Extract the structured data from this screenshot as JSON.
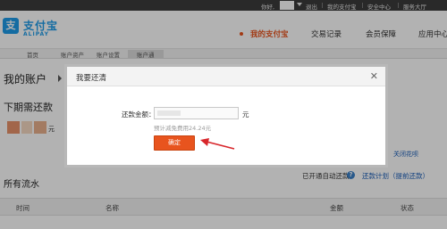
{
  "topbar": {
    "greeting": "你好,",
    "logout": "退出",
    "my_alipay": "我的支付宝",
    "security": "安全中心",
    "service": "服务大厅"
  },
  "header": {
    "logo_cn": "支付宝",
    "logo_en": "ALIPAY",
    "nav": [
      "我的支付宝",
      "交易记录",
      "会员保障",
      "应用中心"
    ]
  },
  "subnav": [
    "首页",
    "账户资产",
    "账户设置",
    "账户通"
  ],
  "page": {
    "title": "我的账户",
    "next_repay": "下期需还款",
    "yuan": "元",
    "close_link": "关闭花呗",
    "auto_repay": "已开通自动还款",
    "plan_link": "还款计划（提前还款）",
    "flow_title": "所有流水",
    "columns": [
      "时间",
      "名称",
      "金额",
      "状态"
    ]
  },
  "modal": {
    "title": "我要还清",
    "amount_label": "还款金额：",
    "unit": "元",
    "hint": "预计减免费用24.24元",
    "confirm": "确定"
  },
  "colors": {
    "brand_blue": "#1e9be8",
    "accent_orange": "#e8541e",
    "link_blue": "#1a5db8"
  },
  "icons": [
    "alipay-logo-icon",
    "help-icon",
    "close-icon",
    "arrow-annotation-icon"
  ]
}
